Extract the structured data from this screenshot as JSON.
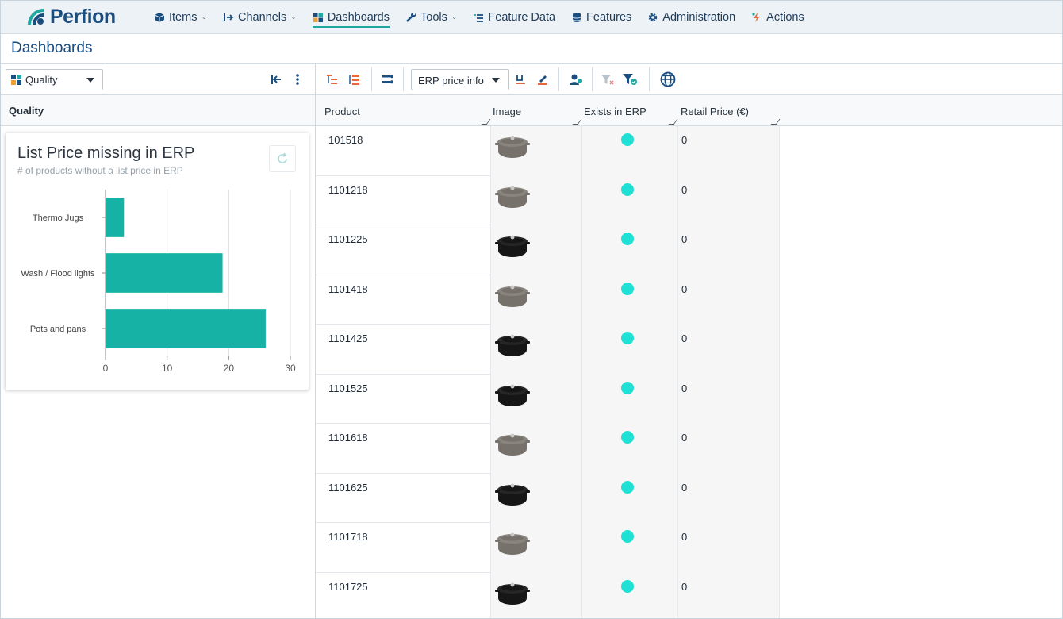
{
  "brand": {
    "name": "Perfion"
  },
  "nav": [
    {
      "label": "Items",
      "icon": "cube-icon",
      "chevron": true,
      "active": false
    },
    {
      "label": "Channels",
      "icon": "channel-arrow-icon",
      "chevron": true,
      "active": false
    },
    {
      "label": "Dashboards",
      "icon": "dashboard-grid-icon",
      "chevron": false,
      "active": true
    },
    {
      "label": "Tools",
      "icon": "wrench-icon",
      "chevron": true,
      "active": false
    },
    {
      "label": "Feature Data",
      "icon": "list-icon",
      "chevron": false,
      "active": false
    },
    {
      "label": "Features",
      "icon": "database-icon",
      "chevron": false,
      "active": false
    },
    {
      "label": "Administration",
      "icon": "gear-icon",
      "chevron": false,
      "active": false
    },
    {
      "label": "Actions",
      "icon": "lightning-icon",
      "chevron": false,
      "active": false
    }
  ],
  "page": {
    "title": "Dashboards"
  },
  "left": {
    "dashboard_select": "Quality",
    "section_header": "Quality",
    "card": {
      "title": "List Price missing in ERP",
      "subtitle": "# of products without a list price in ERP"
    }
  },
  "chart_data": {
    "type": "bar",
    "orientation": "horizontal",
    "title": "List Price missing in ERP",
    "subtitle": "# of products without a list price in ERP",
    "categories": [
      "Thermo Jugs",
      "Wash / Flood lights",
      "Pots and pans"
    ],
    "values": [
      3,
      19,
      26
    ],
    "xlim": [
      0,
      30
    ],
    "xticks": [
      "0",
      "10",
      "20",
      "30"
    ],
    "grid": true,
    "color": "#16b2a6"
  },
  "right": {
    "view_select": "ERP price info",
    "columns": [
      "Product",
      "Image",
      "Exists in ERP",
      "Retail Price (€)"
    ],
    "rows": [
      {
        "product": "101518",
        "image_tone": "grey",
        "exists_in_erp": true,
        "retail_price": "0"
      },
      {
        "product": "1101218",
        "image_tone": "grey",
        "exists_in_erp": true,
        "retail_price": "0"
      },
      {
        "product": "1101225",
        "image_tone": "black",
        "exists_in_erp": true,
        "retail_price": "0"
      },
      {
        "product": "1101418",
        "image_tone": "grey",
        "exists_in_erp": true,
        "retail_price": "0"
      },
      {
        "product": "1101425",
        "image_tone": "black",
        "exists_in_erp": true,
        "retail_price": "0"
      },
      {
        "product": "1101525",
        "image_tone": "black",
        "exists_in_erp": true,
        "retail_price": "0"
      },
      {
        "product": "1101618",
        "image_tone": "grey",
        "exists_in_erp": true,
        "retail_price": "0"
      },
      {
        "product": "1101625",
        "image_tone": "black",
        "exists_in_erp": true,
        "retail_price": "0"
      },
      {
        "product": "1101718",
        "image_tone": "grey",
        "exists_in_erp": true,
        "retail_price": "0"
      },
      {
        "product": "1101725",
        "image_tone": "black",
        "exists_in_erp": true,
        "retail_price": "0"
      }
    ]
  },
  "colors": {
    "brand": "#1a4d80",
    "accent": "#1fa7a0",
    "bar": "#16b2a6",
    "status_dot": "#1ee0d4"
  }
}
